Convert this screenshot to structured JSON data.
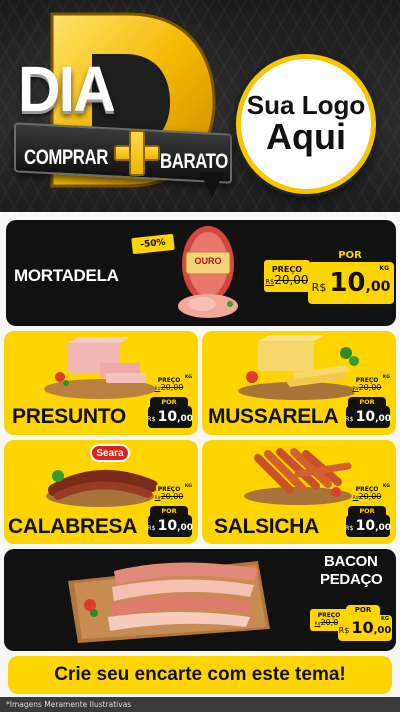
{
  "header": {
    "brand_big": "DIA",
    "brand_d": "D",
    "slogan_left": "COMPRAR",
    "slogan_right": "BARATO",
    "logo_line1": "Sua Logo",
    "logo_line2": "Aqui"
  },
  "colors": {
    "yellow": "#ffd500",
    "black": "#111111",
    "white": "#ffffff"
  },
  "featured": {
    "name": "MORTADELA",
    "brand_label": "OURO",
    "discount": "-50%",
    "preco_label": "PREÇO",
    "old_price": "20,00",
    "old_currency": "R$",
    "por_label": "POR",
    "currency": "R$",
    "price_int": "10",
    "price_dec": ",00",
    "unit": "KG"
  },
  "products": [
    {
      "name": "PRESUNTO",
      "preco_label": "PREÇO",
      "old_currency": "R$",
      "old_price": "20,00",
      "por_label": "POR",
      "currency": "R$",
      "price_int": "10",
      "price_dec": ",00",
      "unit": "KG"
    },
    {
      "name": "MUSSARELA",
      "preco_label": "PREÇO",
      "old_currency": "R$",
      "old_price": "20,00",
      "por_label": "POR",
      "currency": "R$",
      "price_int": "10",
      "price_dec": ",00",
      "unit": "KG"
    },
    {
      "name": "CALABRESA",
      "brand_label": "Seara",
      "preco_label": "PREÇO",
      "old_currency": "R$",
      "old_price": "20,00",
      "por_label": "POR",
      "currency": "R$",
      "price_int": "10",
      "price_dec": ",00",
      "unit": "KG"
    },
    {
      "name": "SALSICHA",
      "preco_label": "PREÇO",
      "old_currency": "R$",
      "old_price": "20,00",
      "por_label": "POR",
      "currency": "R$",
      "price_int": "10",
      "price_dec": ",00",
      "unit": "KG"
    }
  ],
  "bacon": {
    "name_line1": "BACON",
    "name_line2": "PEDAÇO",
    "preco_label": "PREÇO",
    "old_currency": "R$",
    "old_price": "20,00",
    "por_label": "POR",
    "currency": "R$",
    "price_int": "10",
    "price_dec": ",00",
    "unit": "KG"
  },
  "cta": "Crie seu encarte com este tema!",
  "footer_note": "*Imagens Meramente Ilustrativas"
}
